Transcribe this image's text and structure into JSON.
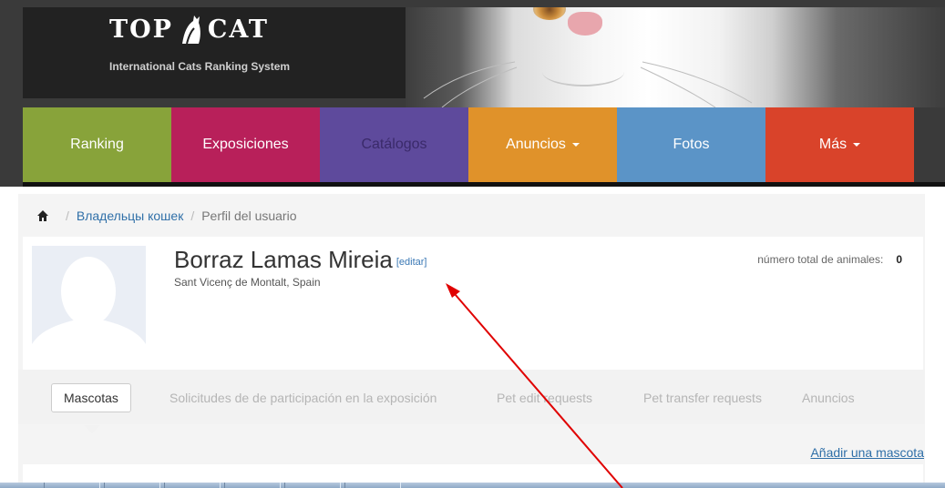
{
  "header": {
    "logo_left": "TOP",
    "logo_right": "CAT",
    "logo_subtitle": "International Cats Ranking System"
  },
  "nav": {
    "items": [
      {
        "label": "Ranking",
        "color": "#88a33a",
        "text_color": "#ffffff",
        "has_caret": false
      },
      {
        "label": "Exposiciones",
        "color": "#b8205a",
        "text_color": "#ffffff",
        "has_caret": false
      },
      {
        "label": "Catálogos",
        "color": "#5e4a9c",
        "text_color": "#3a2a6a",
        "has_caret": false
      },
      {
        "label": "Anuncios",
        "color": "#e0922a",
        "text_color": "#ffffff",
        "has_caret": true
      },
      {
        "label": "Fotos",
        "color": "#5b94c7",
        "text_color": "#ffffff",
        "has_caret": false
      },
      {
        "label": "Más",
        "color": "#d9432a",
        "text_color": "#ffffff",
        "has_caret": true
      }
    ]
  },
  "breadcrumb": {
    "separator": "/",
    "link": "Владельцы кошек",
    "current": "Perfil del usuario"
  },
  "profile": {
    "name": "Borraz Lamas Mireia",
    "edit_label": "[editar]",
    "location": "Sant Vicenç de Montalt, Spain",
    "animals_label": "número total de animales:",
    "animals_count": "0"
  },
  "tabs": [
    {
      "label": "Mascotas",
      "active": true
    },
    {
      "label": "Solicitudes de de participación en la exposición",
      "active": false
    },
    {
      "label": "Pet edit requests",
      "active": false
    },
    {
      "label": "Pet transfer requests",
      "active": false
    },
    {
      "label": "Anuncios",
      "active": false
    }
  ],
  "add_pet_label": "Añadir una mascota",
  "colors": {
    "link": "#2f6fa8",
    "annotation_arrow": "#e00000"
  }
}
